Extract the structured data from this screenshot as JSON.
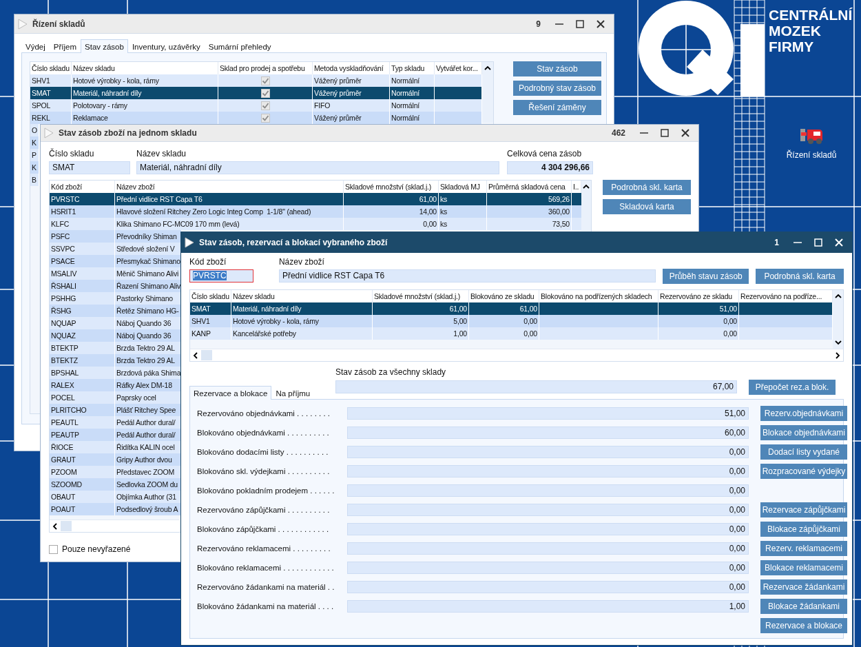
{
  "desktop": {
    "logo_lines": [
      "CENTRÁLNÍ",
      "MOZEK",
      "FIRMY"
    ],
    "shortcuts": [
      {
        "label": "Řízení skladů"
      }
    ]
  },
  "warehouse_window": {
    "title": "Řízení skladů",
    "counter": "9",
    "active": false,
    "tabs": [
      {
        "label": "Výdej",
        "selected": false
      },
      {
        "label": "Příjem",
        "selected": false
      },
      {
        "label": "Stav zásob",
        "selected": true
      },
      {
        "label": "Inventury, uzávěrky",
        "selected": false
      },
      {
        "label": "Sumární přehledy",
        "selected": false
      }
    ],
    "table": {
      "columns": [
        "Číslo skladu",
        "Název skladu",
        "Sklad pro prodej a spotřebu",
        "Metoda vyskladňování",
        "Typ skladu",
        "Vytvářet kor..."
      ],
      "rows": [
        {
          "code": "SHV1",
          "name": "Hotové výrobky - kola, rámy",
          "for_sale": true,
          "method": "Vážený průměr",
          "type": "Normální",
          "selected": false
        },
        {
          "code": "SMAT",
          "name": "Materiál, náhradní díly",
          "for_sale": true,
          "method": "Vážený průměr",
          "type": "Normální",
          "selected": true
        },
        {
          "code": "SPOL",
          "name": "Polotovary - rámy",
          "for_sale": true,
          "method": "FIFO",
          "type": "Normální",
          "selected": false
        },
        {
          "code": "REKL",
          "name": "Reklamace",
          "for_sale": true,
          "method": "Vážený průměr",
          "type": "Normální",
          "selected": false
        }
      ],
      "covered_rows": [
        {
          "code": "O"
        },
        {
          "code": "K"
        },
        {
          "code": "P"
        },
        {
          "code": "K"
        },
        {
          "code": "B"
        }
      ]
    },
    "buttons": [
      "Stav zásob",
      "Podrobný stav zásob",
      "Řešení záměny"
    ]
  },
  "stock_window": {
    "title": "Stav zásob zboží na jednom skladu",
    "counter": "462",
    "active": false,
    "fields": [
      {
        "label": "Číslo skladu",
        "value": "SMAT",
        "kind": "short"
      },
      {
        "label": "Název skladu",
        "value": "Materiál, náhradní díly",
        "kind": "wide"
      },
      {
        "label": "Celková cena zásob",
        "value": "4 304 296,66",
        "kind": "total"
      }
    ],
    "table": {
      "columns": [
        "Kód zboží",
        "Název zboží",
        "Skladové množství (sklad.j.)",
        "Skladová MJ",
        "Průměrná skladová cena",
        "I.."
      ],
      "rows": [
        {
          "cells": [
            "PVRSTC",
            "Přední vidlice RST Capa T6",
            "61,00",
            "ks",
            "569,26"
          ],
          "selected": true
        },
        {
          "cells": [
            "HSRIT1",
            "Hlavové složení Ritchey Zero Logic Integ Comp  1-1/8\" (ahead)",
            "14,00",
            "ks",
            "360,00"
          ],
          "selected": false
        },
        {
          "cells": [
            "KLFC",
            "Klika Shimano FC-MC09 170 mm (levá)",
            "0,00",
            "ks",
            "73,50"
          ],
          "selected": false
        },
        {
          "cells": [
            "PSFC",
            "Převodníky Shiman"
          ],
          "selected": false
        },
        {
          "cells": [
            "SSVPC",
            "Středové složení V"
          ],
          "selected": false
        },
        {
          "cells": [
            "PSACE",
            "Přesmykač Shimano"
          ],
          "selected": false
        },
        {
          "cells": [
            "MSALIV",
            "Měnič Shimano Alivi"
          ],
          "selected": false
        },
        {
          "cells": [
            "ŘSHALI",
            "Řazení Shimano Aliv"
          ],
          "selected": false
        },
        {
          "cells": [
            "PSHHG",
            "Pastorky Shimano"
          ],
          "selected": false
        },
        {
          "cells": [
            "ŘSHG",
            "Řetěz Shimano HG-"
          ],
          "selected": false
        },
        {
          "cells": [
            "NQUAP",
            "Náboj Quando 36"
          ],
          "selected": false
        },
        {
          "cells": [
            "NQUAZ",
            "Náboj Quando 36"
          ],
          "selected": false
        },
        {
          "cells": [
            "BTEKTP",
            "Brzda Tektro 29 AL"
          ],
          "selected": false
        },
        {
          "cells": [
            "BTEKTZ",
            "Brzda Tektro 29 AL"
          ],
          "selected": false
        },
        {
          "cells": [
            "BPSHAL",
            "Brzdová páka Shima"
          ],
          "selected": false
        },
        {
          "cells": [
            "RALEX",
            "Ráfky Alex DM-18"
          ],
          "selected": false
        },
        {
          "cells": [
            "POCEL",
            "Paprsky ocel"
          ],
          "selected": false
        },
        {
          "cells": [
            "PLRITCHO",
            "Plášť Ritchey Spee"
          ],
          "selected": false
        },
        {
          "cells": [
            "PEAUTL",
            "Pedál Author dural/"
          ],
          "selected": false
        },
        {
          "cells": [
            "PEAUTP",
            "Pedál Author dural/"
          ],
          "selected": false
        },
        {
          "cells": [
            "ŘIOCE",
            "Řidítka KALIN ocel"
          ],
          "selected": false
        },
        {
          "cells": [
            "GRAUT",
            "Gripy Author dvou"
          ],
          "selected": false
        },
        {
          "cells": [
            "PZOOM",
            "Představec ZOOM"
          ],
          "selected": false
        },
        {
          "cells": [
            "SZOOMD",
            "Sedlovka ZOOM du"
          ],
          "selected": false
        },
        {
          "cells": [
            "OBAUT",
            "Objímka Author (31"
          ],
          "selected": false
        },
        {
          "cells": [
            "POAUT",
            "Podsedlový šroub A"
          ],
          "selected": false
        }
      ]
    },
    "buttons": [
      "Podrobná skl. karta",
      "Skladová karta"
    ],
    "filter": {
      "label": "Pouze nevyřazené",
      "checked": false
    }
  },
  "item_window": {
    "title": "Stav zásob, rezervací a blokací vybraného zboží",
    "counter": "1",
    "active": true,
    "code_field": {
      "label": "Kód zboží",
      "value": "PVRSTC",
      "focused": true
    },
    "name_field": {
      "label": "Název zboží",
      "value": "Přední vidlice RST Capa T6"
    },
    "buttons": [
      "Průběh stavu zásob",
      "Podrobná skl. karta"
    ],
    "table": {
      "columns": [
        "Číslo skladu",
        "Název skladu",
        "Skladové množství (sklad.j.)",
        "Blokováno ze skladu",
        "Blokováno na podřízených skladech",
        "Rezervováno ze skladu",
        "Rezervováno na podříze..."
      ],
      "rows": [
        {
          "code": "SMAT",
          "name": "Materiál, náhradní díly",
          "qty": "61,00",
          "blocked": "61,00",
          "reserved": "51,00",
          "selected": true
        },
        {
          "code": "SHV1",
          "name": "Hotové výrobky - kola, rámy",
          "qty": "5,00",
          "blocked": "0,00",
          "reserved": "0,00",
          "selected": false
        },
        {
          "code": "KANP",
          "name": "Kancelářské potřeby",
          "qty": "1,00",
          "blocked": "0,00",
          "reserved": "0,00",
          "selected": false
        }
      ]
    },
    "total": {
      "label": "Stav zásob za všechny sklady",
      "value": "67,00",
      "button": "Přepočet rez.a blok."
    },
    "tabs": [
      {
        "label": "Rezervace a blokace",
        "selected": true
      },
      {
        "label": "Na příjmu",
        "selected": false
      }
    ],
    "lines": [
      {
        "label": "Rezervováno objednávkami . . . . . . . .",
        "value": "51,00",
        "button": "Rezerv.objednávkami"
      },
      {
        "label": "Blokováno objednávkami . . . . . . . . . .",
        "value": "60,00",
        "button": "Blokace objednávkami"
      },
      {
        "label": "Blokováno dodacími listy . . . . . . . . . .",
        "value": "0,00",
        "button": "Dodací listy vydané"
      },
      {
        "label": "Blokováno skl. výdejkami . . . . . . . . . .",
        "value": "0,00",
        "button": "Rozpracované výdejky"
      },
      {
        "label": "Blokováno pokladním prodejem . . . . . .",
        "value": "0,00"
      },
      {
        "label": "Rezervováno zápůjčkami . . . . . . . . . .",
        "value": "0,00",
        "button": "Rezervace zápůjčkami"
      },
      {
        "label": "Blokováno zápůjčkami . . . . . . . . . . . .",
        "value": "0,00",
        "button": "Blokace zápůjčkami"
      },
      {
        "label": "Rezervováno reklamacemi . . . . . . . . .",
        "value": "0,00",
        "button": "Rezerv. reklamacemi"
      },
      {
        "label": "Blokováno reklamacemi . . . . . . . . . . . .",
        "value": "0,00",
        "button": "Blokace reklamacemi"
      },
      {
        "label": "Rezervováno žádankami na materiál . .",
        "value": "0,00",
        "button": "Rezervace žádankami"
      },
      {
        "label": "Blokováno žádankami na materiál . . . .",
        "value": "1,00",
        "button": "Blokace žádankami"
      }
    ],
    "final_button": "Rezervace a blokace"
  }
}
